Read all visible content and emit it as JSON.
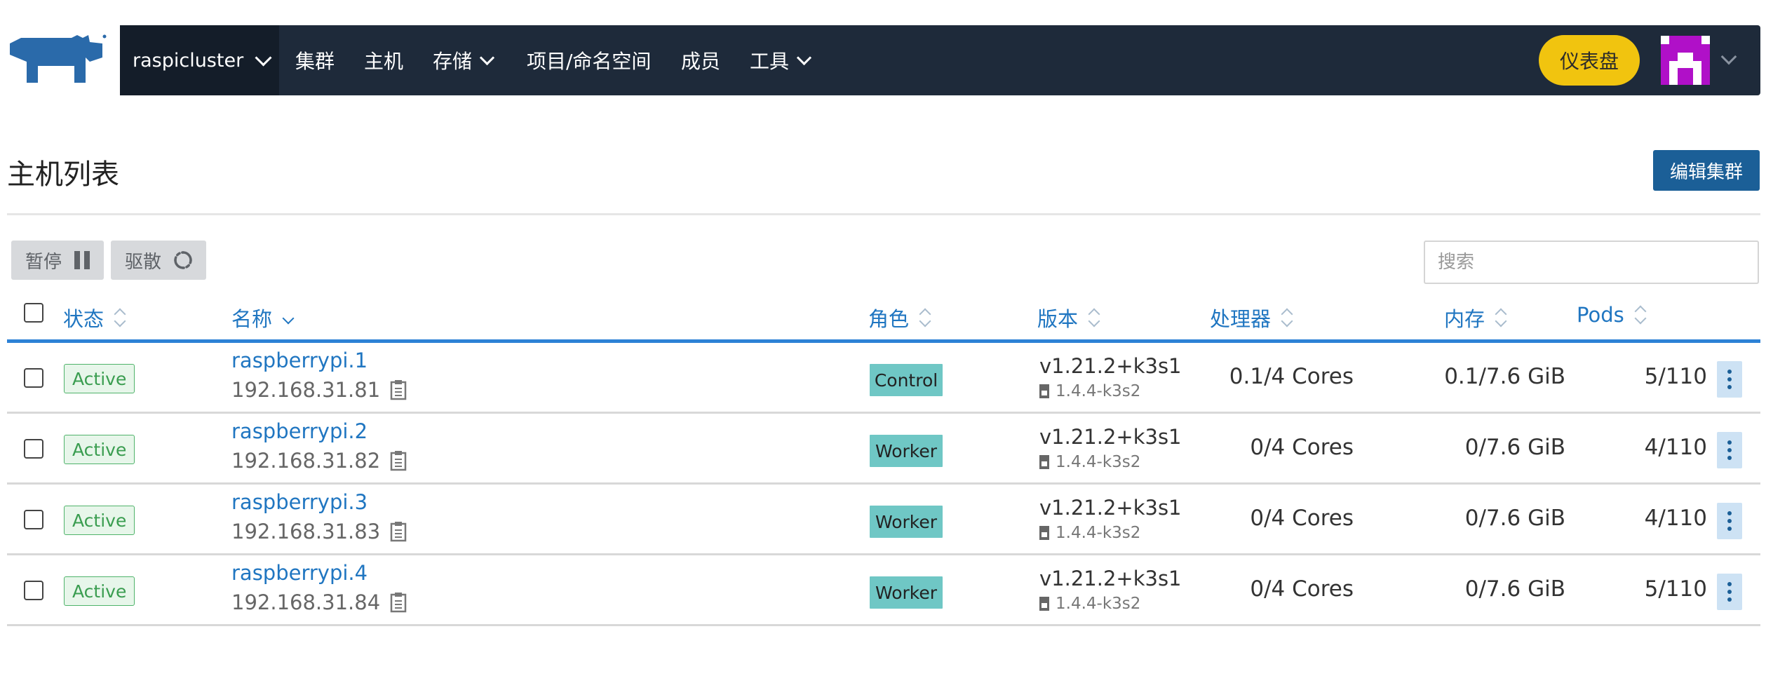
{
  "header": {
    "cluster_name": "raspicluster",
    "nav": [
      {
        "label": "集群",
        "dropdown": false
      },
      {
        "label": "主机",
        "dropdown": false
      },
      {
        "label": "存储",
        "dropdown": true
      },
      {
        "label": "项目/命名空间",
        "dropdown": false
      },
      {
        "label": "成员",
        "dropdown": false
      },
      {
        "label": "工具",
        "dropdown": true
      }
    ],
    "dashboard_label": "仪表盘",
    "colors": {
      "navbar": "#1e2a3a",
      "cluster_bg": "#141d29",
      "dashboard": "#f1c40f",
      "avatar": "#b010c8",
      "logo": "#2a6aaa"
    }
  },
  "page": {
    "title": "主机列表",
    "edit_button": "编辑集群"
  },
  "toolbar": {
    "pause_label": "暂停",
    "evacuate_label": "驱散",
    "search_placeholder": "搜索"
  },
  "table": {
    "columns": {
      "state": "状态",
      "name": "名称",
      "role": "角色",
      "version": "版本",
      "cpu": "处理器",
      "memory": "内存",
      "pods": "Pods"
    },
    "sorted_by": "name",
    "rows": [
      {
        "state": "Active",
        "name": "raspberrypi.1",
        "ip": "192.168.31.81",
        "role": "Control",
        "version": "v1.21.2+k3s1",
        "agent": "1.4.4-k3s2",
        "cpu": "0.1/4 Cores",
        "memory": "0.1/7.6 GiB",
        "pods": "5/110"
      },
      {
        "state": "Active",
        "name": "raspberrypi.2",
        "ip": "192.168.31.82",
        "role": "Worker",
        "version": "v1.21.2+k3s1",
        "agent": "1.4.4-k3s2",
        "cpu": "0/4 Cores",
        "memory": "0/7.6 GiB",
        "pods": "4/110"
      },
      {
        "state": "Active",
        "name": "raspberrypi.3",
        "ip": "192.168.31.83",
        "role": "Worker",
        "version": "v1.21.2+k3s1",
        "agent": "1.4.4-k3s2",
        "cpu": "0/4 Cores",
        "memory": "0/7.6 GiB",
        "pods": "4/110"
      },
      {
        "state": "Active",
        "name": "raspberrypi.4",
        "ip": "192.168.31.84",
        "role": "Worker",
        "version": "v1.21.2+k3s1",
        "agent": "1.4.4-k3s2",
        "cpu": "0/4 Cores",
        "memory": "0/7.6 GiB",
        "pods": "5/110"
      }
    ]
  }
}
